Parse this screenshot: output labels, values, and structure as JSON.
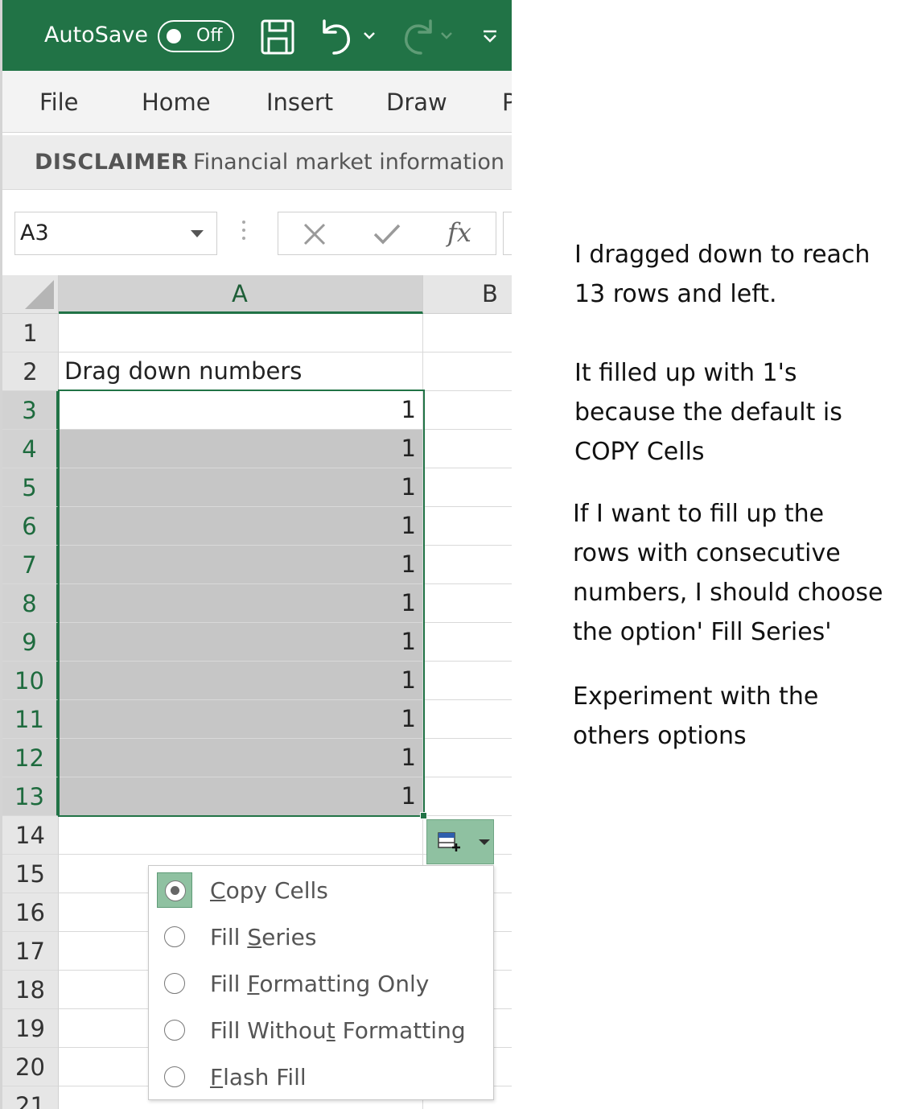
{
  "titlebar": {
    "autosave_label": "AutoSave",
    "autosave_state": "Off",
    "icons": [
      "save-icon",
      "undo-icon",
      "redo-icon",
      "customize-qat-icon"
    ]
  },
  "ribbon": {
    "tabs": [
      "File",
      "Home",
      "Insert",
      "Draw",
      "P"
    ]
  },
  "disclaimer": {
    "title": "DISCLAIMER",
    "text": "Financial market information is"
  },
  "formula_bar": {
    "name_box": "A3",
    "fx_label": "fx"
  },
  "grid": {
    "columns": [
      "A",
      "B"
    ],
    "row_numbers": [
      "1",
      "2",
      "3",
      "4",
      "5",
      "6",
      "7",
      "8",
      "9",
      "10",
      "11",
      "12",
      "13",
      "14",
      "15",
      "16",
      "17",
      "18",
      "19",
      "20",
      "21"
    ],
    "cells": [
      "",
      "Drag down numbers",
      "1",
      "1",
      "1",
      "1",
      "1",
      "1",
      "1",
      "1",
      "1",
      "1",
      "1"
    ]
  },
  "autofill_menu": {
    "options": [
      {
        "label": "Copy Cells",
        "selected": true
      },
      {
        "label": "Fill Series",
        "selected": false
      },
      {
        "label": "Fill Formatting Only",
        "selected": false
      },
      {
        "label": "Fill Without Formatting",
        "selected": false
      },
      {
        "label": "Flash Fill",
        "selected": false
      }
    ]
  },
  "notes": {
    "p1": "I dragged down to reach\n13 rows and left.",
    "p2": "It filled up with 1's\nbecause the default is\nCOPY Cells",
    "p3": " If I want to fill up the\nrows with consecutive\nnumbers, I should choose\nthe option' Fill Series'",
    "p4": "Experiment with the\nothers options"
  },
  "colors": {
    "excel_green": "#217346",
    "selection_fill": "#c6c6c6",
    "menu_highlight": "#8fc1a1"
  }
}
